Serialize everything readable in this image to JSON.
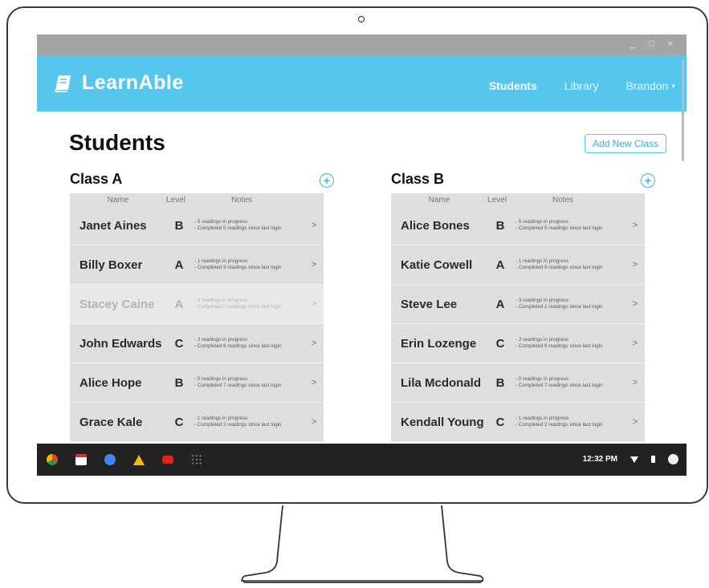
{
  "window": {
    "controls": "_ □ ×"
  },
  "app": {
    "name": "LearnAble"
  },
  "nav": {
    "items": [
      {
        "label": "Students",
        "active": true
      },
      {
        "label": "Library",
        "active": false
      }
    ],
    "user": "Brandon",
    "caret": "▾"
  },
  "page": {
    "title": "Students",
    "add_class_label": "Add New Class"
  },
  "columns": {
    "name": "Name",
    "level": "Level",
    "notes": "Notes"
  },
  "classes": [
    {
      "title": "Class A",
      "add_icon": "plus-circle-icon",
      "students": [
        {
          "name": "Janet Aines",
          "level": "B",
          "note1": "- 5 readings in progress",
          "note2": "- Completed 5 readings since last login",
          "arrow": ">",
          "faded": false
        },
        {
          "name": "Billy Boxer",
          "level": "A",
          "note1": "- 1 readings in progress",
          "note2": "- Completed 9 readings since last login",
          "arrow": ">",
          "faded": false
        },
        {
          "name": "Stacey Caine",
          "level": "A",
          "note1": "- 3 readings in progress",
          "note2": "- Completed 0 readings since last login",
          "arrow": ">",
          "faded": true
        },
        {
          "name": "John Edwards",
          "level": "C",
          "note1": "- 2 readings in progress",
          "note2": "- Completed 6 readings since last login",
          "arrow": ">",
          "faded": false
        },
        {
          "name": "Alice Hope",
          "level": "B",
          "note1": "- 0 readings in progress",
          "note2": "- Completed 7 readings since last login",
          "arrow": ">",
          "faded": false
        },
        {
          "name": "Grace Kale",
          "level": "C",
          "note1": "- 1 readings in progress",
          "note2": "- Completed 2 readings since last login",
          "arrow": ">",
          "faded": false
        }
      ]
    },
    {
      "title": "Class B",
      "add_icon": "plus-circle-icon",
      "students": [
        {
          "name": "Alice Bones",
          "level": "B",
          "note1": "- 5 readings in progress",
          "note2": "- Completed 5 readings since last login",
          "arrow": ">",
          "faded": false
        },
        {
          "name": "Katie Cowell",
          "level": "A",
          "note1": "- 1 readings in progress",
          "note2": "- Completed 9 readings since last login",
          "arrow": ">",
          "faded": false
        },
        {
          "name": "Steve Lee",
          "level": "A",
          "note1": "- 3 readings in progress",
          "note2": "- Completed 1 readings since last login",
          "arrow": ">",
          "faded": false
        },
        {
          "name": "Erin Lozenge",
          "level": "C",
          "note1": "- 2 readings in progress",
          "note2": "- Completed 6 readings since last login",
          "arrow": ">",
          "faded": false
        },
        {
          "name": "Lila Mcdonald",
          "level": "B",
          "note1": "- 0 readings in progress",
          "note2": "- Completed 7 readings since last login",
          "arrow": ">",
          "faded": false
        },
        {
          "name": "Kendall Young",
          "level": "C",
          "note1": "- 1 readings in progress",
          "note2": "- Completed 2 readings since last login",
          "arrow": ">",
          "faded": false
        }
      ]
    }
  ],
  "taskbar": {
    "apps": [
      {
        "icon": "chrome-icon",
        "color": "#e8453c"
      },
      {
        "icon": "gmail-icon",
        "color": "#d93025"
      },
      {
        "icon": "google-plus-icon",
        "color": "#4285f4"
      },
      {
        "icon": "drive-icon",
        "color": "#fbbc05"
      },
      {
        "icon": "youtube-icon",
        "color": "#e62117"
      },
      {
        "icon": "app-launcher-icon",
        "color": "#888888"
      }
    ],
    "time": "12:32 PM"
  },
  "colors": {
    "accent": "#56c6ef",
    "button_border": "#56c6ef"
  }
}
